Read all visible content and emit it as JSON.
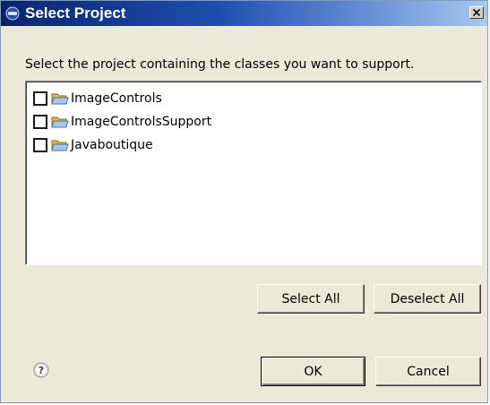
{
  "dialog": {
    "title": "Select Project",
    "instruction": "Select the project containing the classes you want to support."
  },
  "projects": [
    {
      "label": "ImageControls",
      "checked": false
    },
    {
      "label": "ImageControlsSupport",
      "checked": false
    },
    {
      "label": "Javaboutique",
      "checked": false
    }
  ],
  "buttons": {
    "select_all": "Select All",
    "deselect_all": "Deselect All",
    "ok": "OK",
    "cancel": "Cancel"
  },
  "icons": {
    "title": "app-icon",
    "close": "close-icon",
    "folder": "folder-icon",
    "help": "help-icon"
  },
  "colors": {
    "titlebar_start": "#0a246a",
    "titlebar_end": "#a6caf0",
    "dialog_bg": "#ece9d8"
  }
}
